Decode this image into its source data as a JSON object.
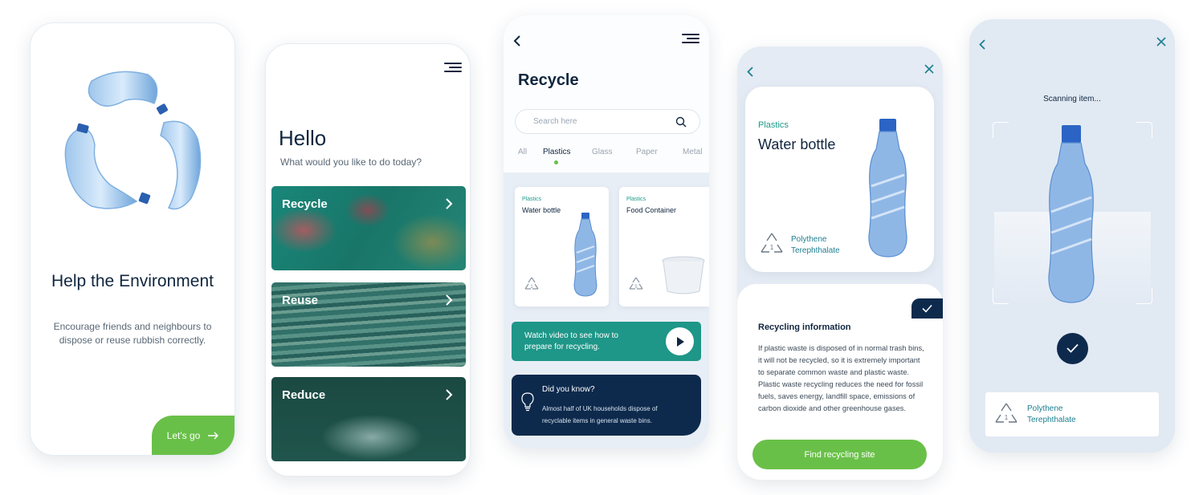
{
  "screen1": {
    "title": "Help the Environment",
    "subtitle": "Encourage friends and neighbours to dispose or reuse rubbish correctly.",
    "cta_label": "Let's go",
    "icon": "arrow-right-icon"
  },
  "screen2": {
    "greeting": "Hello",
    "question": "What would you like to do today?",
    "tiles": [
      {
        "label": "Recycle"
      },
      {
        "label": "Reuse"
      },
      {
        "label": "Reduce"
      }
    ]
  },
  "screen3": {
    "title": "Recycle",
    "search_placeholder": "Search here",
    "tabs": [
      "All",
      "Plastics",
      "Glass",
      "Paper",
      "Metal"
    ],
    "active_tab": "Plastics",
    "products": [
      {
        "category": "Plastics",
        "name": "Water bottle"
      },
      {
        "category": "Plastics",
        "name": "Food Container"
      }
    ],
    "video_text": "Watch video to see how to prepare for recycling.",
    "did_you_know_title": "Did you know?",
    "did_you_know_body": "Almost half of UK households dispose of recyclable items in general waste bins."
  },
  "screen4": {
    "category": "Plastics",
    "name": "Water bottle",
    "plastic_type": "Polythene Terephthalate",
    "info_title": "Recycling information",
    "info_body": "If plastic waste is disposed of in normal trash bins, it will not be recycled, so it is extremely important to separate common waste and plastic waste.  Plastic waste recycling reduces the need for fossil fuels, saves energy, landfill space, emissions of carbon dioxide and other greenhouse gases.",
    "button_label": "Find recycling site"
  },
  "screen5": {
    "status": "Scanning item...",
    "plastic_type": "Polythene Terephthalate"
  },
  "colors": {
    "green": "#69c048",
    "teal": "#1e9688",
    "navy": "#0d2a4d",
    "text": "#10263f"
  }
}
